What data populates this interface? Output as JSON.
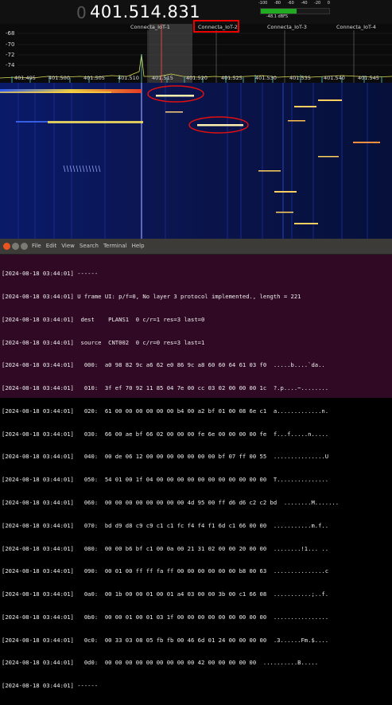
{
  "sdr": {
    "frequency_prefix": "0",
    "frequency": "401.514.831",
    "level_ticks": [
      "-100",
      "-80",
      "-60",
      "-40",
      "-20",
      "0"
    ],
    "level_readout": "-48.1 dBFS",
    "level_fraction": 0.52,
    "db_labels": [
      "-68",
      "-70",
      "-72",
      "-74"
    ],
    "channels": [
      "Connecta_IoT-1",
      "Connecta_IoT-2",
      "Connecta_IoT-3",
      "Connecta_IoT-4"
    ],
    "freq_ticks": [
      "401.495",
      "401.500",
      "401.505",
      "401.510",
      "401.515",
      "401.520",
      "401.525",
      "401.530",
      "401.535",
      "401.540",
      "401.545"
    ]
  },
  "terminal": {
    "menu": [
      "File",
      "Edit",
      "View",
      "Search",
      "Terminal",
      "Help"
    ],
    "lines": [
      "[2024-08-18 03:44:01] ------",
      "[2024-08-18 03:44:01] U frame UI: p/f=0, No layer 3 protocol implemented., length = 221",
      "[2024-08-18 03:44:01]  dest    PLANS1  0 c/r=1 res=3 last=0",
      "[2024-08-18 03:44:01]  source  CNT002  0 c/r=0 res=3 last=1",
      "[2024-08-18 03:44:01]   000:  a0 98 82 9c a6 62 e0 86 9c a8 60 60 64 61 03 f0  .....b....`da..",
      "[2024-08-18 03:44:01]   010:  3f ef 70 92 11 85 04 7e 00 cc 03 02 00 00 00 1c  ?.p....~........",
      "[2024-08-18 03:44:01]   020:  61 00 00 00 00 00 00 b4 00 a2 bf 01 00 08 6e c1  a.............n.",
      "[2024-08-18 03:44:01]   030:  66 00 ae bf 66 02 00 00 00 fe 6e 00 00 00 00 fe  f...f.....n.....",
      "[2024-08-18 03:44:01]   040:  00 de 06 12 00 00 00 00 00 00 00 bf 07 ff 00 55  ...............U",
      "[2024-08-18 03:44:01]   050:  54 01 00 1f 04 00 00 00 00 00 00 00 00 00 00 00  T...............",
      "[2024-08-18 03:44:01]   060:  00 00 00 00 00 00 00 00 4d 95 00 ff d6 d6 c2 c2 bd  ........M.......",
      "[2024-08-18 03:44:01]   070:  bd d9 d8 c9 c9 c1 c1 fc f4 f4 f1 6d c1 66 00 00  ...........m.f..",
      "[2024-08-18 03:44:01]   080:  00 00 b6 bf c1 00 0a 00 21 31 02 00 00 20 00 00  ........!1... ..",
      "[2024-08-18 03:44:01]   090:  00 01 00 ff ff fa ff 00 00 00 00 00 00 b8 00 63  ...............c",
      "[2024-08-18 03:44:01]   0a0:  00 1b 00 00 01 00 01 a4 03 00 00 3b 00 c1 66 08  ...........;..f.",
      "[2024-08-18 03:44:01]   0b0:  00 00 01 00 01 03 1f 00 00 00 00 00 00 00 00 00  ................",
      "[2024-08-18 03:44:01]   0c0:  00 33 03 08 05 fb fb 00 46 6d 01 24 00 00 00 00  .3......Fm.$....",
      "[2024-08-18 03:44:01]   0d0:  00 00 00 00 00 00 00 00 00 42 00 00 00 00 00  ..........B.....",
      "[2024-08-18 03:44:01] ------"
    ]
  }
}
